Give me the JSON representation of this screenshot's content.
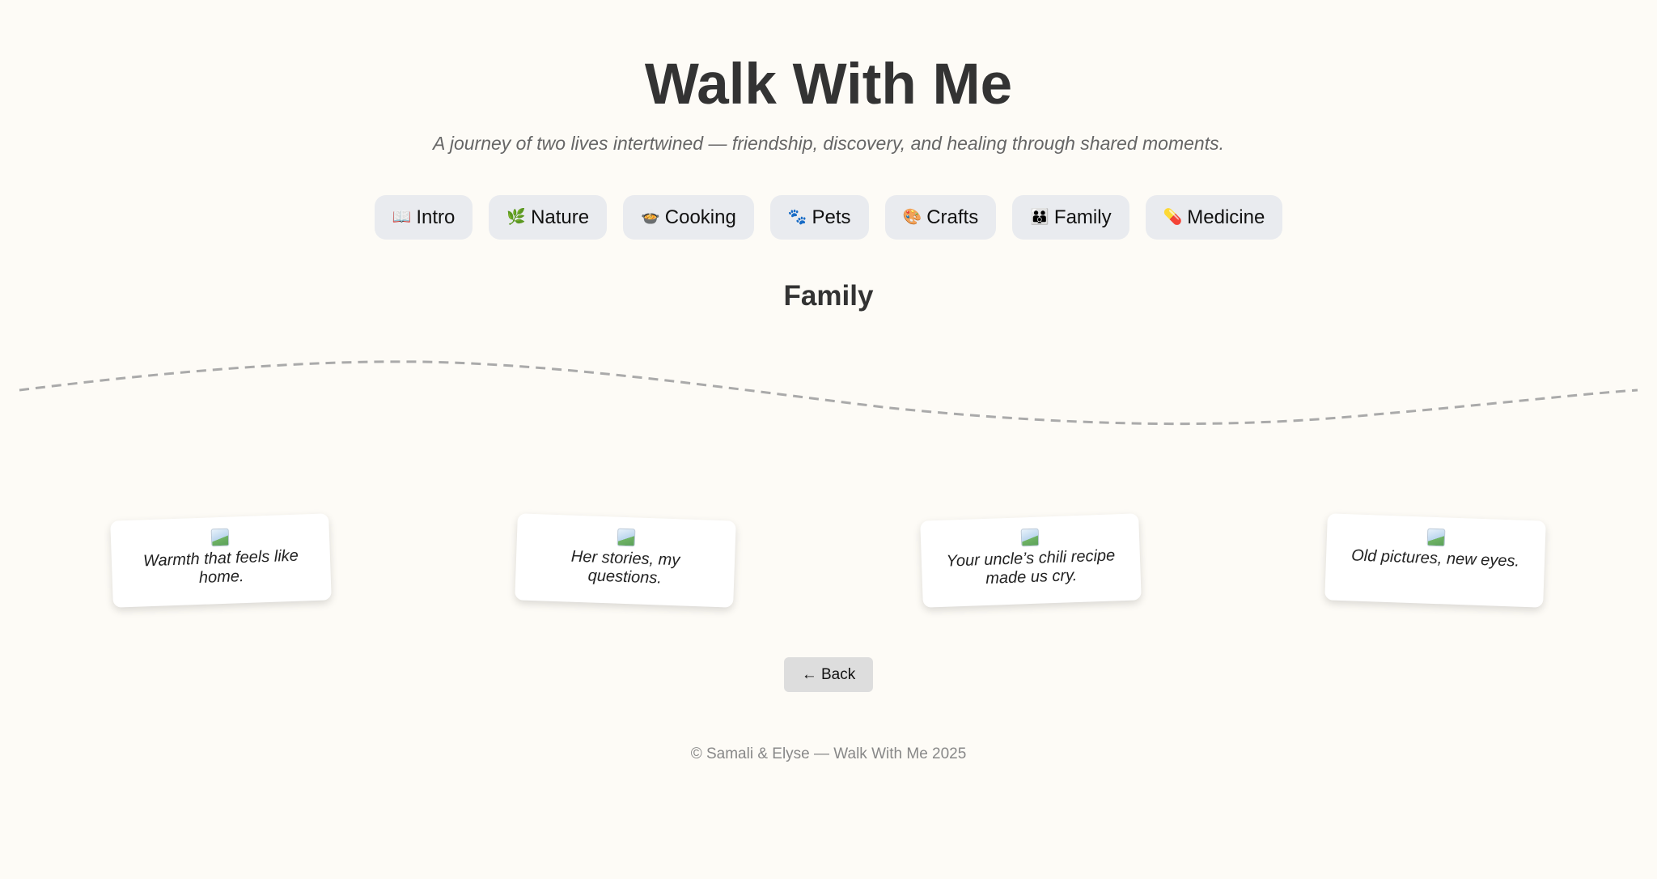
{
  "header": {
    "title": "Walk With Me",
    "subtitle": "A journey of two lives intertwined — friendship, discovery, and healing through shared moments."
  },
  "nav": {
    "items": [
      {
        "icon": "📖",
        "icon_name": "book-icon",
        "label": "Intro"
      },
      {
        "icon": "🌿",
        "icon_name": "herb-icon",
        "label": "Nature"
      },
      {
        "icon": "🍲",
        "icon_name": "pot-of-food-icon",
        "label": "Cooking"
      },
      {
        "icon": "🐾",
        "icon_name": "paw-prints-icon",
        "label": "Pets"
      },
      {
        "icon": "🎨",
        "icon_name": "palette-icon",
        "label": "Crafts"
      },
      {
        "icon": "👪",
        "icon_name": "family-icon",
        "label": "Family"
      },
      {
        "icon": "💊",
        "icon_name": "pill-icon",
        "label": "Medicine"
      }
    ]
  },
  "section": {
    "title": "Family"
  },
  "cards": [
    {
      "caption": "Warmth that feels like home.",
      "image": "broken-image-icon"
    },
    {
      "caption": "Her stories, my questions.",
      "image": "broken-image-icon"
    },
    {
      "caption": "Your uncle’s chili recipe made us cry.",
      "image": "broken-image-icon"
    },
    {
      "caption": "Old pictures, new eyes.",
      "image": "broken-image-icon"
    }
  ],
  "back_button": {
    "label": "← Back"
  },
  "footer": {
    "text": "© Samali & Elyse — Walk With Me 2025"
  },
  "colors": {
    "background": "#fdfbf6",
    "nav_button_bg": "#e9ebef",
    "back_button_bg": "#dddddd",
    "path_dash": "#aaaaaa"
  }
}
